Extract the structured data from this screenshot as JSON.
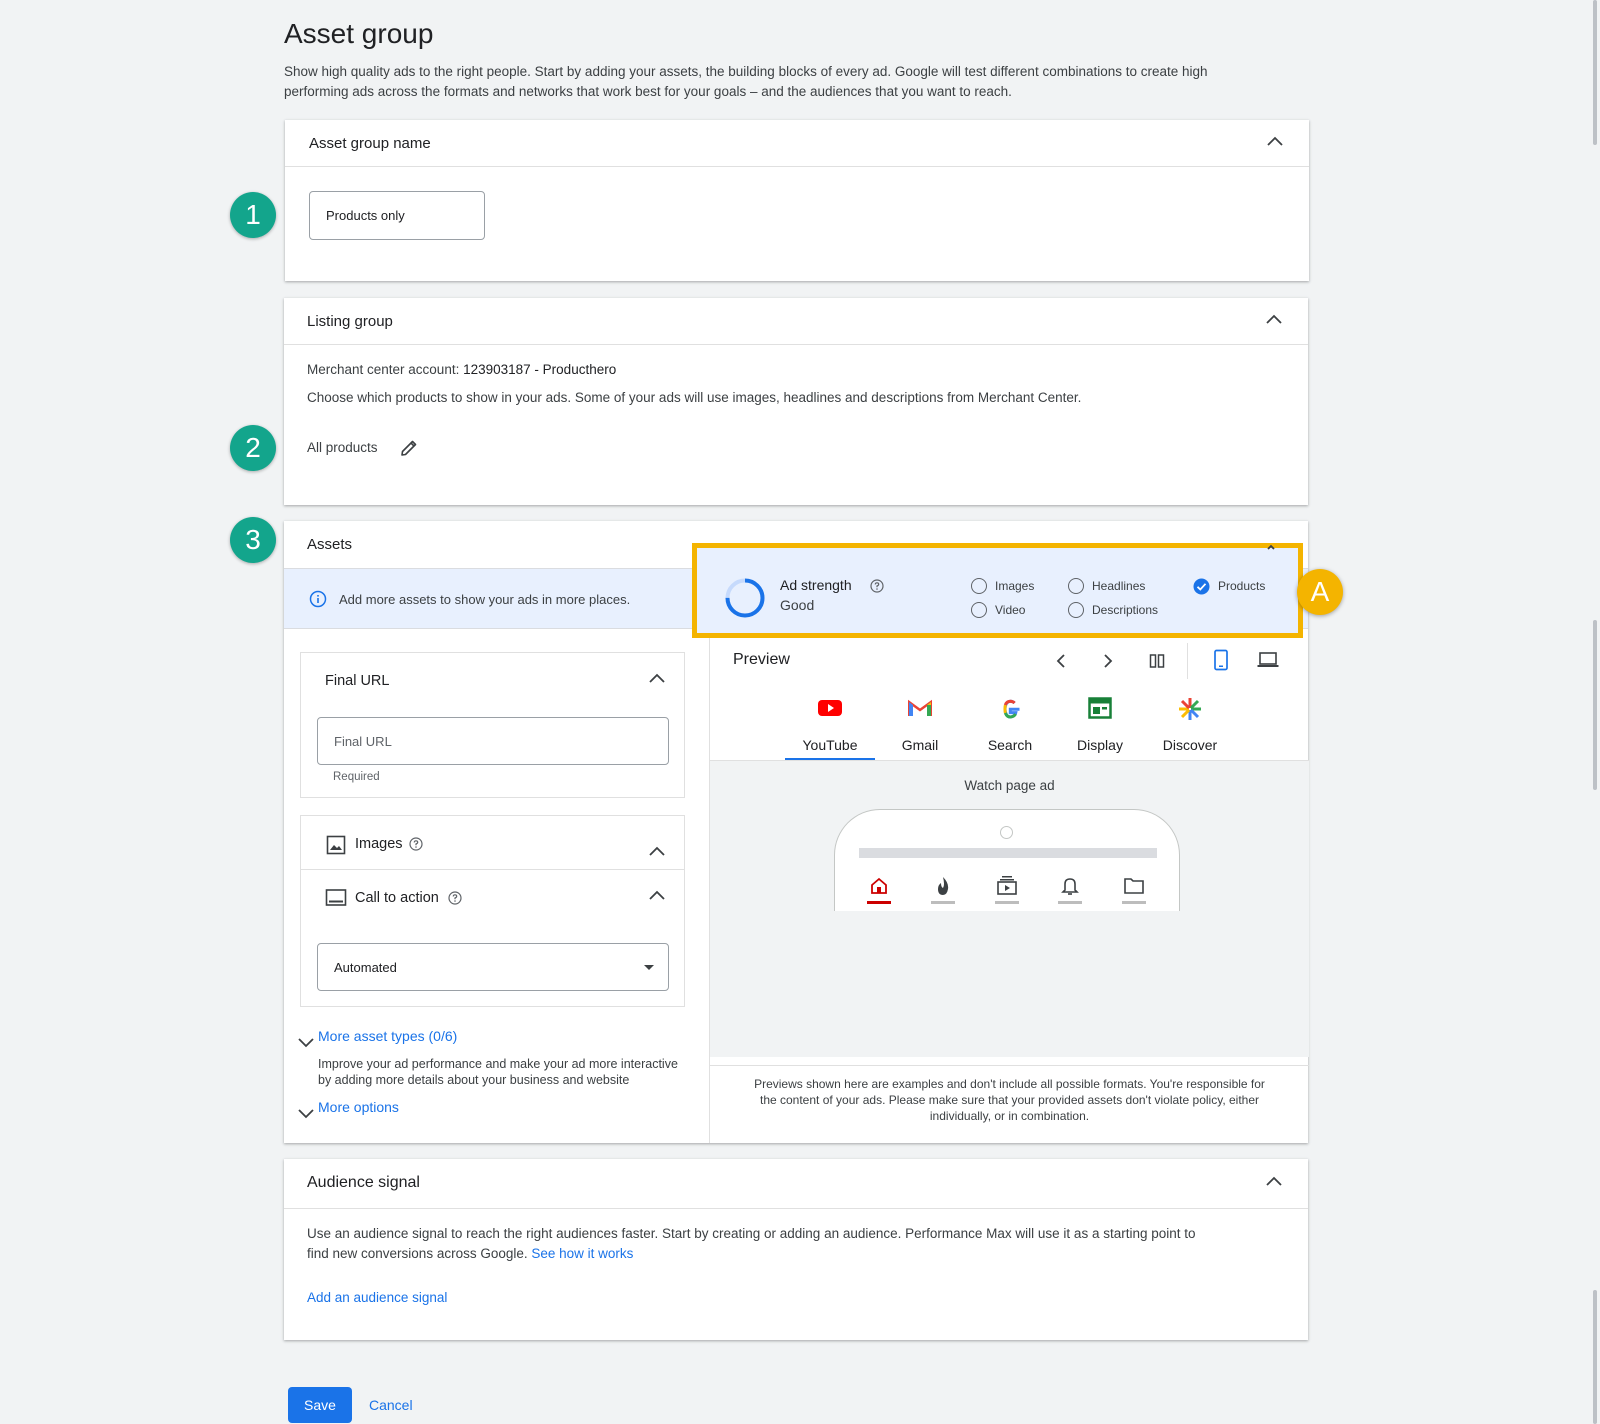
{
  "page": {
    "title": "Asset group",
    "description_line1": "Show high quality ads to the right people. Start by adding your assets, the building blocks of every ad. Google will test different combinations to create high",
    "description_line2": "performing ads across the formats and networks that work best for your goals – and the audiences that you want to reach."
  },
  "steps": {
    "one": "1",
    "two": "2",
    "three": "3",
    "a": "A"
  },
  "asset_group_name": {
    "title": "Asset group name",
    "value": "Products only"
  },
  "listing_group": {
    "title": "Listing group",
    "merchant_label": "Merchant center account:",
    "merchant_value": "123903187 - Producthero",
    "choose_text": "Choose which products to show in your ads. Some of your ads will use images, headlines and descriptions from Merchant Center.",
    "selection": "All products"
  },
  "assets": {
    "title": "Assets",
    "info_text": "Add more assets to show your ads in more places.",
    "ad_strength_label": "Ad strength",
    "ad_strength_value": "Good",
    "ad_strength_fraction": 0.75,
    "checklist": [
      {
        "label": "Images",
        "checked": false
      },
      {
        "label": "Video",
        "checked": false
      },
      {
        "label": "Headlines",
        "checked": false
      },
      {
        "label": "Descriptions",
        "checked": false
      },
      {
        "label": "Products",
        "checked": true
      }
    ],
    "final_url": {
      "title": "Final URL",
      "placeholder": "Final URL",
      "helper": "Required"
    },
    "images": {
      "title": "Images"
    },
    "call_to_action": {
      "title": "Call to action",
      "value": "Automated"
    },
    "more_asset_types": "More asset types (0/6)",
    "more_asset_desc_1": "Improve your ad performance and make your ad more interactive",
    "more_asset_desc_2": "by adding more details about your business and website",
    "more_options": "More options"
  },
  "preview": {
    "title": "Preview",
    "tabs": [
      {
        "label": "YouTube",
        "icon": "youtube-icon"
      },
      {
        "label": "Gmail",
        "icon": "gmail-icon"
      },
      {
        "label": "Search",
        "icon": "google-icon"
      },
      {
        "label": "Display",
        "icon": "display-icon"
      },
      {
        "label": "Discover",
        "icon": "discover-icon"
      }
    ],
    "active_tab": "YouTube",
    "ad_label": "Watch page ad",
    "disclaimer_1": "Previews shown here are examples and don't include all possible formats. You're responsible for",
    "disclaimer_2": "the content of your ads. Please make sure that your provided assets don't violate policy, either",
    "disclaimer_3": "individually, or in combination."
  },
  "audience_signal": {
    "title": "Audience signal",
    "text_1": "Use an audience signal to reach the right audiences faster. Start by creating or adding an audience. Performance Max will use it as a starting point to",
    "text_2": "find new conversions across Google.",
    "link": "See how it works",
    "add_link": "Add an audience signal"
  },
  "footer": {
    "save": "Save",
    "cancel": "Cancel"
  },
  "colors": {
    "accent": "#1a73e8",
    "step_badge": "#13a58c",
    "highlight": "#f4b400",
    "info_bg": "#e8f0fe"
  }
}
